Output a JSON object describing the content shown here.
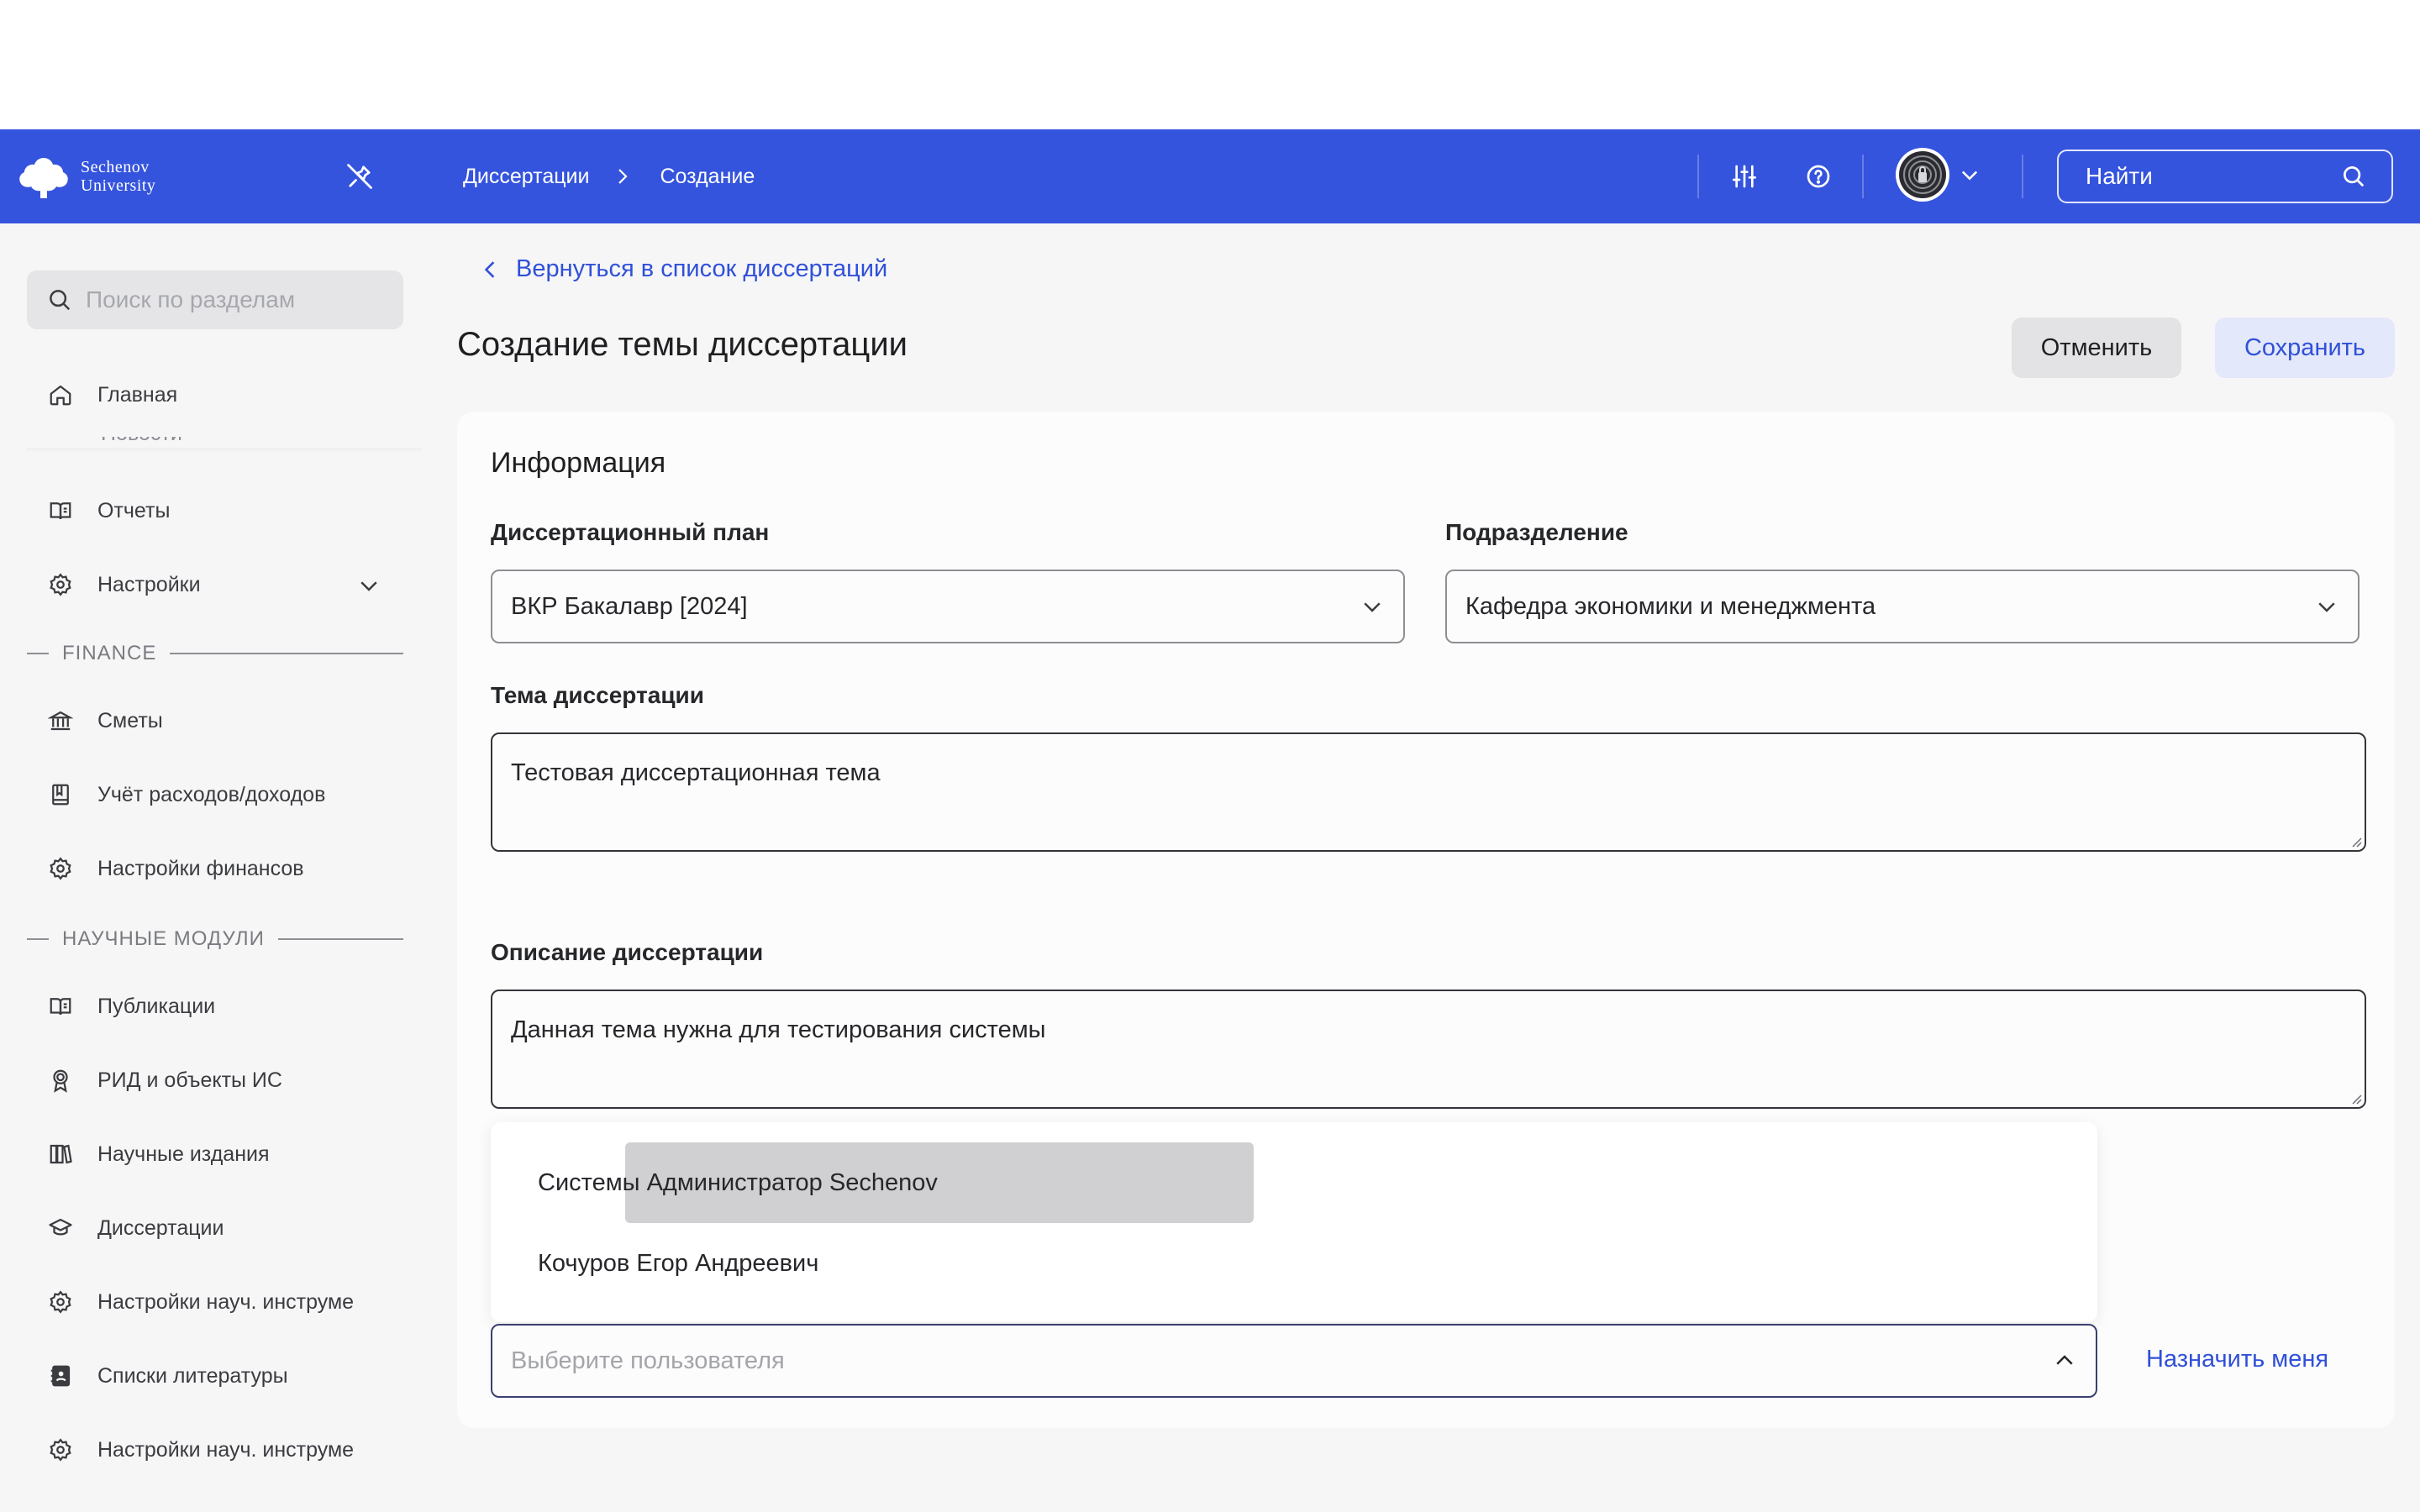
{
  "topbar": {
    "logo_line1": "Sechenov",
    "logo_line2": "University",
    "breadcrumbs": [
      "Диссертации",
      "Создание"
    ],
    "search_placeholder": "Найти",
    "icons": [
      "pin-off-icon",
      "sliders-icon",
      "help-icon",
      "avatar",
      "chevron-down-icon",
      "search-icon"
    ]
  },
  "sidebar": {
    "search_placeholder": "Поиск по разделам",
    "items_top": [
      {
        "label": "Главная",
        "icon": "home-icon"
      },
      {
        "label": "Отчеты",
        "icon": "book-open-icon"
      },
      {
        "label": "Настройки",
        "icon": "gear-icon"
      }
    ],
    "clipped_item": "Новости",
    "section_finance": "FINANCE",
    "items_finance": [
      {
        "label": "Сметы",
        "icon": "bank-icon"
      },
      {
        "label": "Учёт расходов/доходов",
        "icon": "ledger-icon"
      },
      {
        "label": "Настройки финансов",
        "icon": "gear-icon"
      }
    ],
    "section_science": "НАУЧНЫЕ МОДУЛИ",
    "items_science": [
      {
        "label": "Публикации",
        "icon": "book-open-icon"
      },
      {
        "label": "РИД и объекты ИС",
        "icon": "award-icon"
      },
      {
        "label": "Научные издания",
        "icon": "books-icon"
      },
      {
        "label": "Диссертации",
        "icon": "graduation-cap-icon"
      },
      {
        "label": "Настройки науч. инструме",
        "icon": "gear-icon"
      },
      {
        "label": "Списки литературы",
        "icon": "contacts-book-icon"
      },
      {
        "label": "Настройки науч. инструме",
        "icon": "gear-icon"
      }
    ]
  },
  "main": {
    "back_link": "Вернуться в список диссертаций",
    "page_title": "Создание темы диссертации",
    "cancel_label": "Отменить",
    "save_label": "Сохранить",
    "card_title": "Информация",
    "plan_label": "Диссертационный план",
    "plan_value": "ВКР Бакалавр [2024]",
    "dept_label": "Подразделение",
    "dept_value": "Кафедра экономики и менеджмента",
    "topic_label": "Тема диссертации",
    "topic_value": "Тестовая диссертационная тема",
    "desc_label": "Описание диссертации",
    "desc_value": "Данная тема нужна для тестирования системы",
    "dropdown_options": [
      "Системы Администратор Sechenov",
      "Кочуров Егор Андреевич"
    ],
    "user_placeholder": "Выберите пользователя",
    "assign_me_label": "Назначить меня"
  },
  "colors": {
    "topbar_bg": "#3554dd",
    "accent": "#3050d8",
    "page_bg": "#f6f6f7",
    "highlight": "#d0d0d2"
  }
}
